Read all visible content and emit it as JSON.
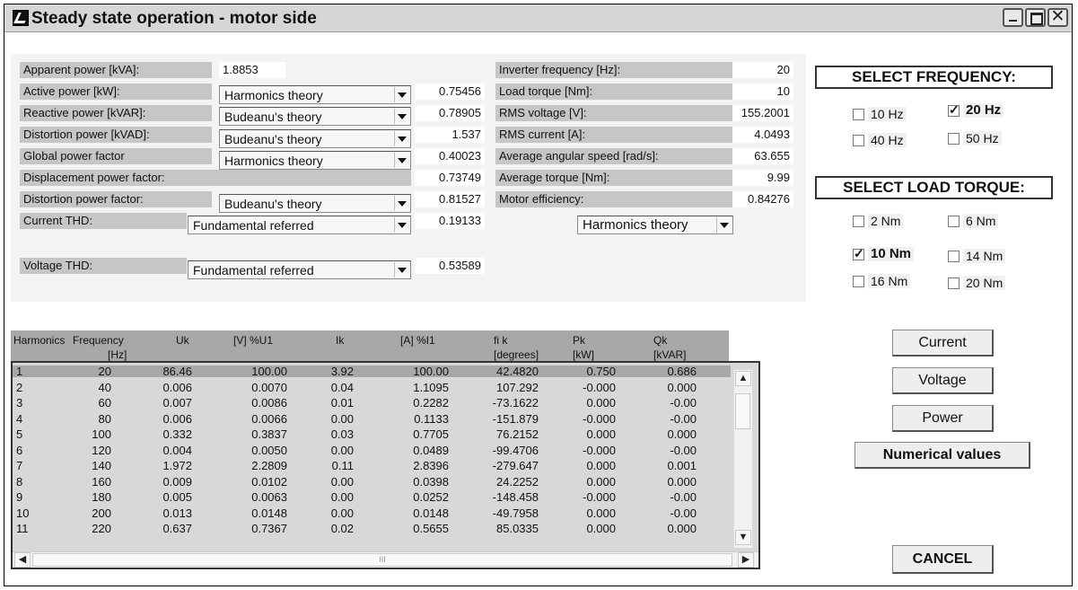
{
  "window": {
    "title": "Steady state operation - motor side",
    "controls": {
      "minimize": "_",
      "maximize": "□",
      "close": "✕"
    }
  },
  "left_params": [
    {
      "label": "Apparent power [kVA]:",
      "value": "1.8853"
    },
    {
      "label": "Active power [kW]:",
      "method": "Harmonics theory",
      "value": "0.75456"
    },
    {
      "label": "Reactive power [kVAR]:",
      "method": "Budeanu's theory",
      "value": "0.78905"
    },
    {
      "label": "Distortion power [kVAD]:",
      "method": "Budeanu's theory",
      "value": "1.537"
    },
    {
      "label": "Global power factor",
      "method": "Harmonics theory",
      "value": "0.40023"
    },
    {
      "label": "Displacement power factor:",
      "value": "0.73749"
    },
    {
      "label": "Distortion power factor:",
      "method": "Budeanu's theory",
      "value": "0.81527"
    },
    {
      "label": "Current THD:",
      "method": "Fundamental referred",
      "value": "0.19133"
    },
    {
      "label": "Voltage THD:",
      "method": "Fundamental referred",
      "value": "0.53589"
    }
  ],
  "right_params": [
    {
      "label": "Inverter frequency [Hz]:",
      "value": "20"
    },
    {
      "label": "Load torque [Nm]:",
      "value": "10"
    },
    {
      "label": "RMS voltage [V]:",
      "value": "155.2001"
    },
    {
      "label": "RMS current [A]:",
      "value": "4.0493"
    },
    {
      "label": "Average angular speed [rad/s]:",
      "value": "63.655"
    },
    {
      "label": "Average torque [Nm]:",
      "value": "9.99"
    },
    {
      "label": "Motor efficiency:",
      "value": "0.84276"
    }
  ],
  "efficiency_method": "Harmonics theory",
  "frequency": {
    "title": "SELECT FREQUENCY:",
    "options": [
      {
        "label": "10 Hz",
        "checked": false
      },
      {
        "label": "20 Hz",
        "checked": true
      },
      {
        "label": "40 Hz",
        "checked": false
      },
      {
        "label": "50 Hz",
        "checked": false
      }
    ]
  },
  "torque": {
    "title": "SELECT LOAD TORQUE:",
    "options": [
      {
        "label": "2 Nm",
        "checked": false
      },
      {
        "label": "6 Nm",
        "checked": false
      },
      {
        "label": "10 Nm",
        "checked": true
      },
      {
        "label": "14 Nm",
        "checked": false
      },
      {
        "label": "16 Nm",
        "checked": false
      },
      {
        "label": "20 Nm",
        "checked": false
      }
    ]
  },
  "buttons": {
    "current": "Current",
    "voltage": "Voltage",
    "power": "Power",
    "numerical": "Numerical values",
    "cancel": "CANCEL"
  },
  "table": {
    "header": {
      "harmonics": "Harmonics",
      "frequency": "Frequency",
      "hz": "[Hz]",
      "uk": "Uk",
      "v_u1": "[V] %U1",
      "ik": "Ik",
      "a_i1": "[A] %I1",
      "fik": "fi k",
      "degrees": "[degrees]",
      "pk": "Pk",
      "kw": "[kW]",
      "qk": "Qk",
      "kvar": "[kVAR]"
    },
    "rows": [
      [
        "1",
        "20",
        "86.46",
        "100.00",
        "3.92",
        "100.00",
        "42.4820",
        "0.750",
        "0.686"
      ],
      [
        "2",
        "40",
        "0.006",
        "0.0070",
        "0.04",
        "1.1095",
        "107.292",
        "-0.000",
        "0.000"
      ],
      [
        "3",
        "60",
        "0.007",
        "0.0086",
        "0.01",
        "0.2282",
        "-73.1622",
        "0.000",
        "-0.00"
      ],
      [
        "4",
        "80",
        "0.006",
        "0.0066",
        "0.00",
        "0.1133",
        "-151.879",
        "-0.000",
        "-0.00"
      ],
      [
        "5",
        "100",
        "0.332",
        "0.3837",
        "0.03",
        "0.7705",
        "76.2152",
        "0.000",
        "0.000"
      ],
      [
        "6",
        "120",
        "0.004",
        "0.0050",
        "0.00",
        "0.0489",
        "-99.4706",
        "-0.000",
        "-0.00"
      ],
      [
        "7",
        "140",
        "1.972",
        "2.2809",
        "0.11",
        "2.8396",
        "-279.647",
        "0.000",
        "0.001"
      ],
      [
        "8",
        "160",
        "0.009",
        "0.0102",
        "0.00",
        "0.0398",
        "24.2252",
        "0.000",
        "0.000"
      ],
      [
        "9",
        "180",
        "0.005",
        "0.0063",
        "0.00",
        "0.0252",
        "-148.458",
        "-0.000",
        "-0.00"
      ],
      [
        "10",
        "200",
        "0.013",
        "0.0148",
        "0.00",
        "0.0148",
        "-49.7958",
        "0.000",
        "-0.00"
      ],
      [
        "11",
        "220",
        "0.637",
        "0.7367",
        "0.02",
        "0.5655",
        "85.0335",
        "0.000",
        "0.000"
      ]
    ],
    "scroll": {
      "up": "▲",
      "down": "▼",
      "left": "◀",
      "right": "▶",
      "grip": "III"
    }
  }
}
